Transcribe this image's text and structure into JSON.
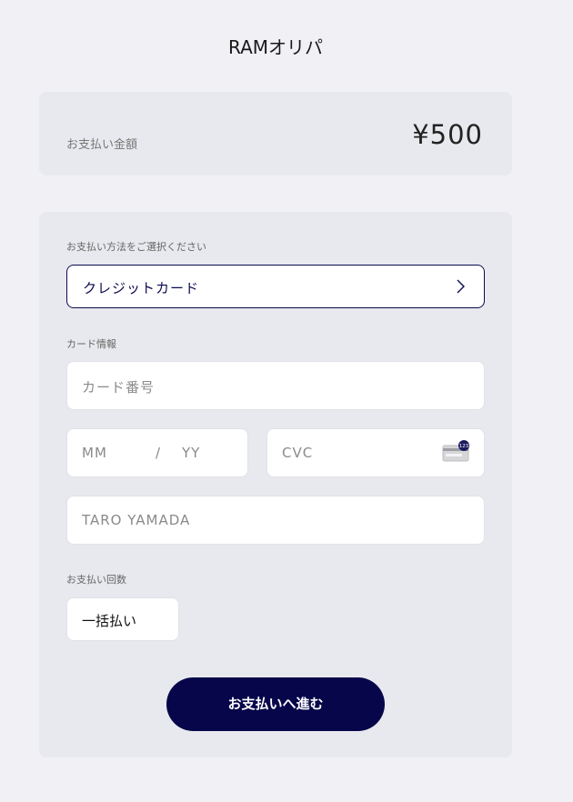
{
  "header": {
    "title": "RAMオリパ"
  },
  "amount": {
    "label": "お支払い金額",
    "value": "¥500"
  },
  "payment_method": {
    "label": "お支払い方法をご選択ください",
    "selected": "クレジットカード"
  },
  "card_info": {
    "label": "カード情報",
    "card_number_placeholder": "カード番号",
    "expiry_month_placeholder": "MM",
    "expiry_separator": "/",
    "expiry_year_placeholder": "YY",
    "cvc_placeholder": "CVC",
    "cvc_icon_badge": "123",
    "name_placeholder": "TARO YAMADA"
  },
  "installments": {
    "label": "お支払い回数",
    "selected": "一括払い"
  },
  "submit_label": "お支払いへ進む",
  "colors": {
    "accent": "#07064a",
    "background": "#f0f0f5",
    "card": "#e8e9ee"
  }
}
